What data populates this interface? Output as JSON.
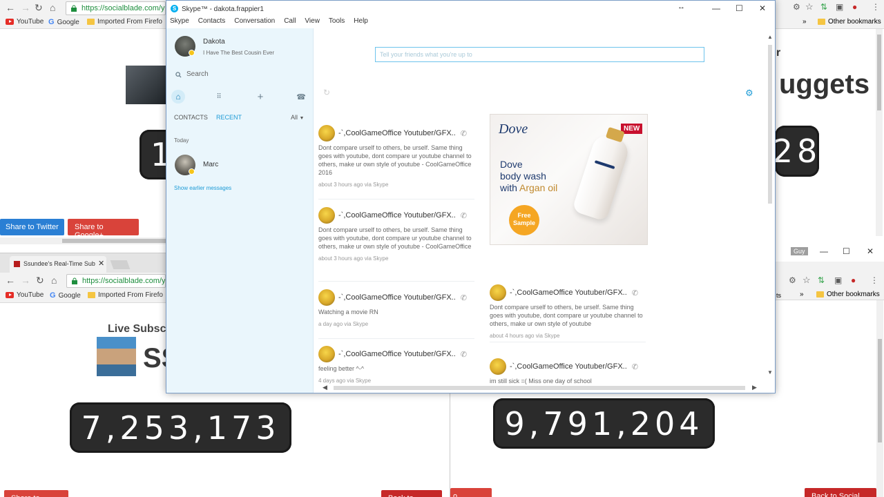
{
  "browser_tl": {
    "url": "https://socialblade.com/yo",
    "bookmarks": [
      "YouTube",
      "Google",
      "Imported From Firefo"
    ],
    "heading_fragment": "",
    "counter_fragment": "1",
    "share_twitter": "Share to Twitter",
    "share_google": "Share to Google+"
  },
  "browser_tr": {
    "bookmark_right": "Other bookmarks",
    "tab_fragment": "r",
    "heading_fragment": "uggets",
    "counter_fragment": "28"
  },
  "browser_bl": {
    "tab_title": "Ssundee's Real-Time Sub",
    "url": "https://socialblade.com/yo",
    "bookmarks": [
      "YouTube",
      "Google",
      "Imported From Firefo"
    ],
    "heading": "Live Subsc",
    "channel_fragment": "SS",
    "counter": "7,253,173",
    "share_google": "Share to Google+",
    "back_button": "Back to Social Bl"
  },
  "browser_br": {
    "user_badge": "Guy",
    "bookmark_right": "Other bookmarks",
    "tab_fragment": "ts",
    "counter": "9,791,204",
    "share_google": "o Google+",
    "back_button": "Back to Social Blad"
  },
  "skype": {
    "title": "Skype™ - dakota.frappier1",
    "menu": [
      "Skype",
      "Contacts",
      "Conversation",
      "Call",
      "View",
      "Tools",
      "Help"
    ],
    "profile": {
      "name": "Dakota",
      "mood": "I Have The Best Cousin Ever"
    },
    "search_placeholder": "Search",
    "tabs": {
      "contacts": "CONTACTS",
      "recent": "RECENT",
      "filter": "All"
    },
    "section_today": "Today",
    "recent_contact": "Marc",
    "show_earlier": "Show earlier messages",
    "mood_input_placeholder": "Tell your friends what you're up to",
    "feed_left": [
      {
        "name": "-`,CoolGameOffice Youtuber/GFX..",
        "text": "Dont compare urself to others, be urself. Same thing goes with youtube, dont compare ur youtube channel to others, make ur own style of youtube - CoolGameOffice 2016",
        "meta": "about 3 hours ago via Skype"
      },
      {
        "name": "-`,CoolGameOffice Youtuber/GFX..",
        "text": "Dont compare urself to others, be urself. Same thing goes with youtube, dont compare ur youtube channel to others, make ur own style of youtube - CoolGameOffice",
        "meta": "about 3 hours ago via Skype"
      },
      {
        "name": "-`,CoolGameOffice Youtuber/GFX..",
        "text": "Watching a movie RN",
        "meta": "a day ago via Skype"
      },
      {
        "name": "-`,CoolGameOffice Youtuber/GFX..",
        "text": "feeling better ^-^",
        "meta": "4 days ago via Skype"
      }
    ],
    "feed_right": [
      {
        "name": "-`,CoolGameOffice Youtuber/GFX..",
        "text": "Dont compare urself to others, be urself. Same thing goes with youtube, dont compare ur youtube channel to others, make ur own style of youtube",
        "meta": "about 4 hours ago via Skype"
      },
      {
        "name": "-`,CoolGameOffice Youtuber/GFX..",
        "text": "im still sick =( Miss one day of school",
        "meta": ""
      }
    ],
    "ad": {
      "brand": "Dove",
      "badge": "NEW",
      "headline_1": "Dove",
      "headline_2": "body wash",
      "headline_3": "with ",
      "headline_accent": "Argan oil",
      "cta_1": "Free",
      "cta_2": "Sample",
      "accent_color": "#f5a623",
      "badge_color": "#c8102e"
    }
  }
}
